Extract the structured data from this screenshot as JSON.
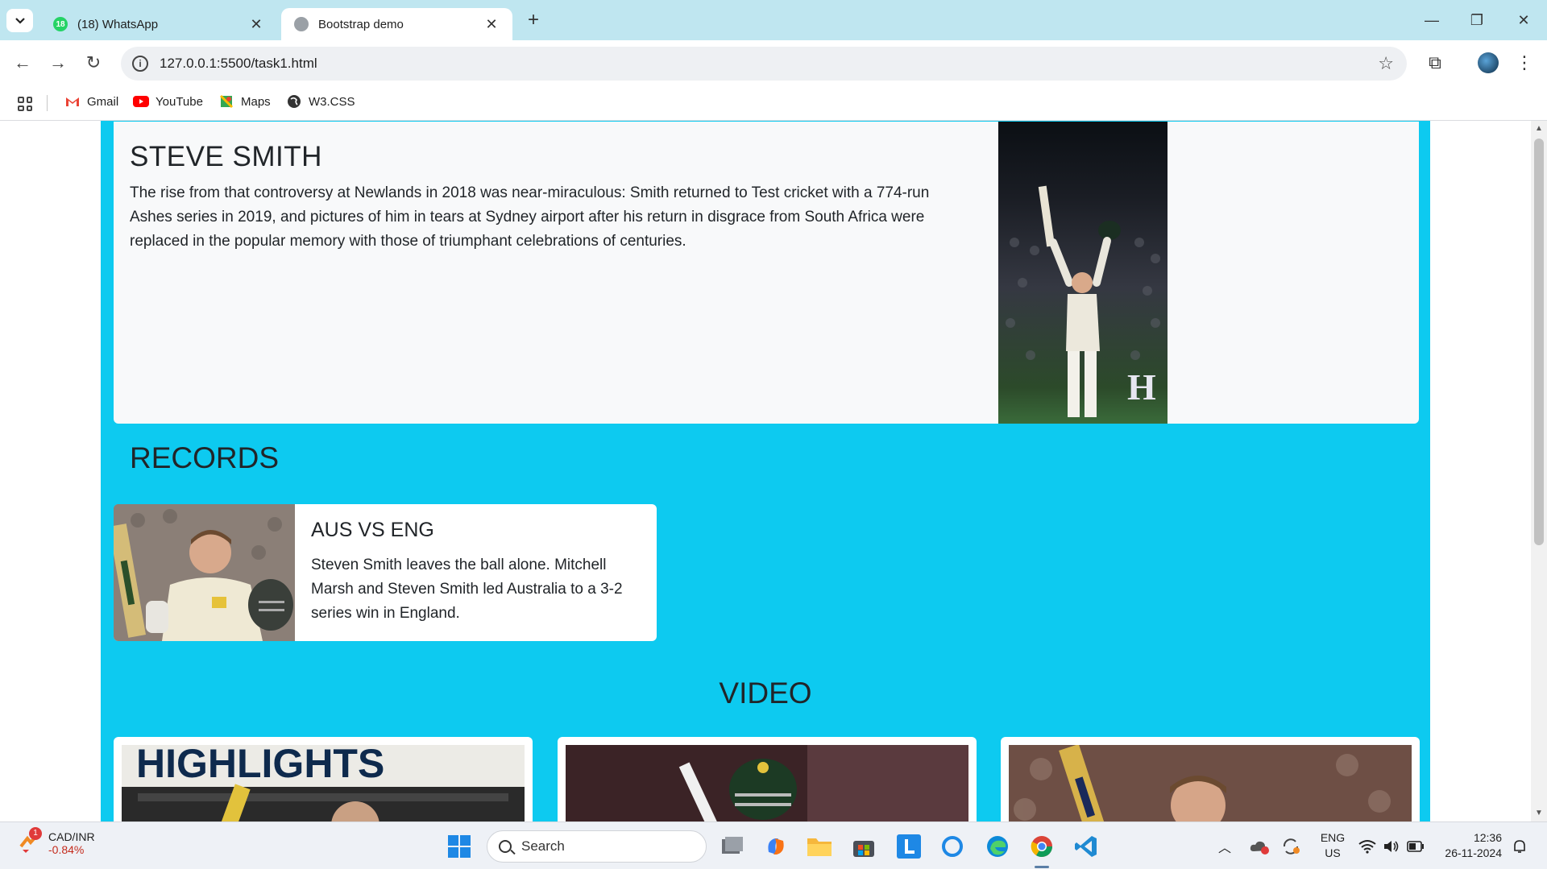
{
  "browser": {
    "tabs": [
      {
        "title": "(18) WhatsApp",
        "badge": "18"
      },
      {
        "title": "Bootstrap demo"
      }
    ],
    "address": "127.0.0.1:5500/task1.html",
    "bookmarks": [
      {
        "label": "Gmail"
      },
      {
        "label": "YouTube"
      },
      {
        "label": "Maps"
      },
      {
        "label": "W3.CSS"
      }
    ]
  },
  "page": {
    "hero": {
      "title": "STEVE SMITH",
      "text": "The rise from that controversy at Newlands in 2018 was near-miraculous: Smith returned to Test cricket with a 774-run Ashes series in 2019, and pictures of him in tears at Sydney airport after his return in disgrace from South Africa were replaced in the popular memory with those of triumphant celebrations of centuries."
    },
    "records": {
      "title": "RECORDS",
      "card": {
        "title": "AUS VS ENG",
        "text": "Steven Smith leaves the ball alone. Mitchell Marsh and Steven Smith led Australia to a 3-2 series win in England."
      }
    },
    "video": {
      "title": "VIDEO",
      "thumb1_text": "HIGHLIGHTS"
    },
    "colors": {
      "section_bg": "#0dcaf0",
      "hero_bg": "#f8f9fa"
    }
  },
  "taskbar": {
    "stock_badge": "1",
    "stock_name": "CAD/INR",
    "stock_change": "-0.84%",
    "search_label": "Search",
    "lang_line1": "ENG",
    "lang_line2": "US",
    "time": "12:36",
    "date": "26-11-2024"
  }
}
